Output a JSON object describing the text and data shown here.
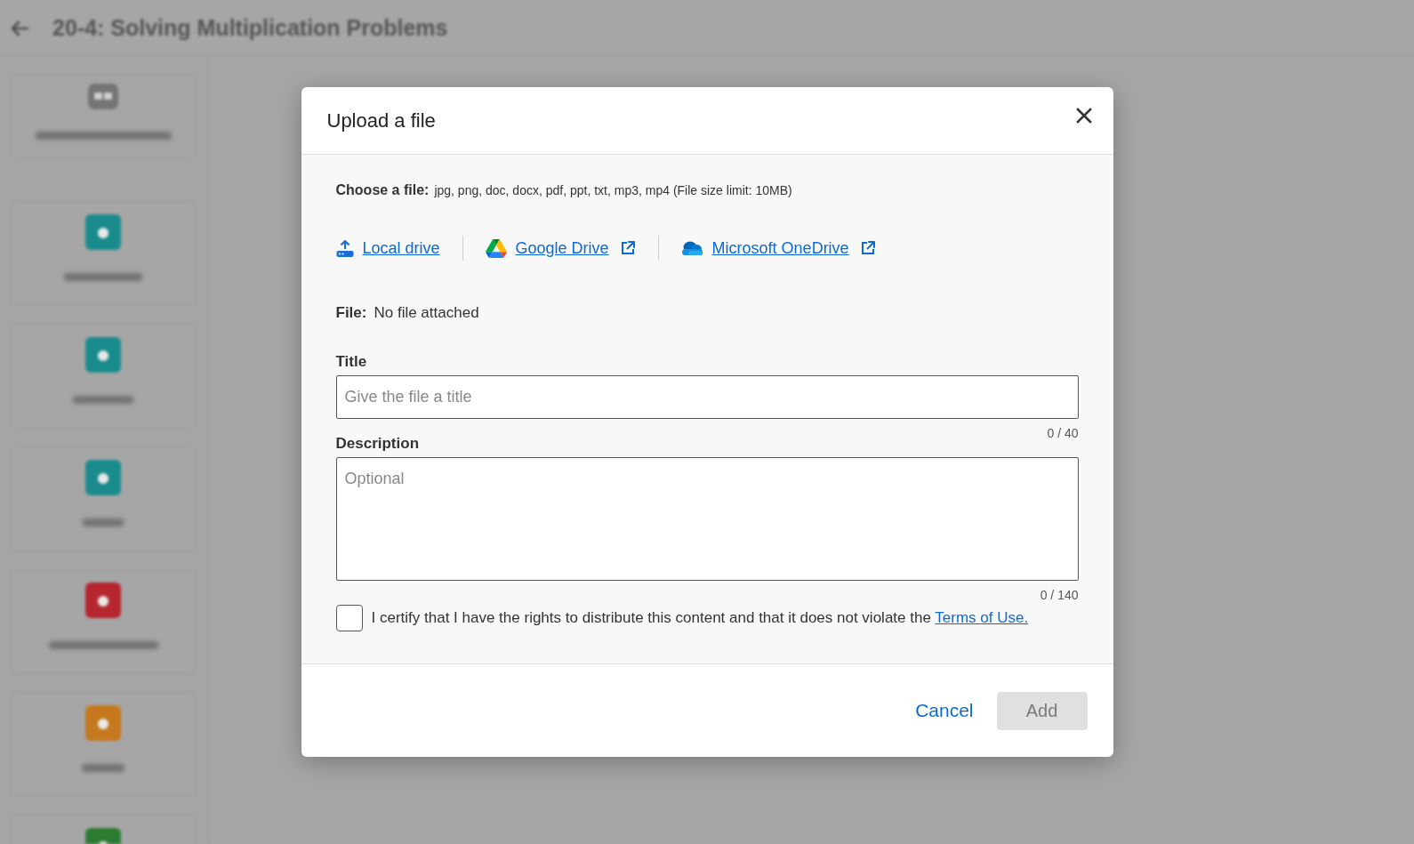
{
  "page": {
    "title": "20-4: Solving Multiplication Problems"
  },
  "sidebar": {
    "items": [
      {
        "kind": "book",
        "color": "#757575"
      },
      {
        "kind": "tile",
        "color": "#1a8b8d"
      },
      {
        "kind": "tile",
        "color": "#1a8b8d"
      },
      {
        "kind": "tile",
        "color": "#1a8b8d"
      },
      {
        "kind": "tile",
        "color": "#b5262f"
      },
      {
        "kind": "tile",
        "color": "#c5781d"
      },
      {
        "kind": "tile",
        "color": "#2b7b32"
      }
    ]
  },
  "dialog": {
    "title": "Upload a file",
    "choose_label": "Choose a file:",
    "file_types": "jpg, png, doc, docx, pdf, ppt, txt, mp3, mp4 (File size limit: 10MB)",
    "sources": [
      {
        "kind": "local",
        "label": "Local drive",
        "external": false
      },
      {
        "kind": "google",
        "label": "Google Drive",
        "external": true
      },
      {
        "kind": "onedrive",
        "label": "Microsoft OneDrive",
        "external": true
      }
    ],
    "file_label": "File:",
    "file_value": "No file attached",
    "fields": [
      {
        "kind": "input",
        "label": "Title",
        "placeholder": "Give the file a title",
        "counter": "0 / 40"
      },
      {
        "kind": "textarea",
        "label": "Description",
        "placeholder": "Optional",
        "counter": "0 / 140"
      }
    ],
    "certify": {
      "checked": false,
      "text": "I certify that I have the rights to distribute this content and that it does not violate the",
      "link": "Terms of Use."
    },
    "buttons": [
      {
        "kind": "link",
        "label": "Cancel",
        "disabled": false
      },
      {
        "kind": "primary",
        "label": "Add",
        "disabled": true
      }
    ]
  }
}
